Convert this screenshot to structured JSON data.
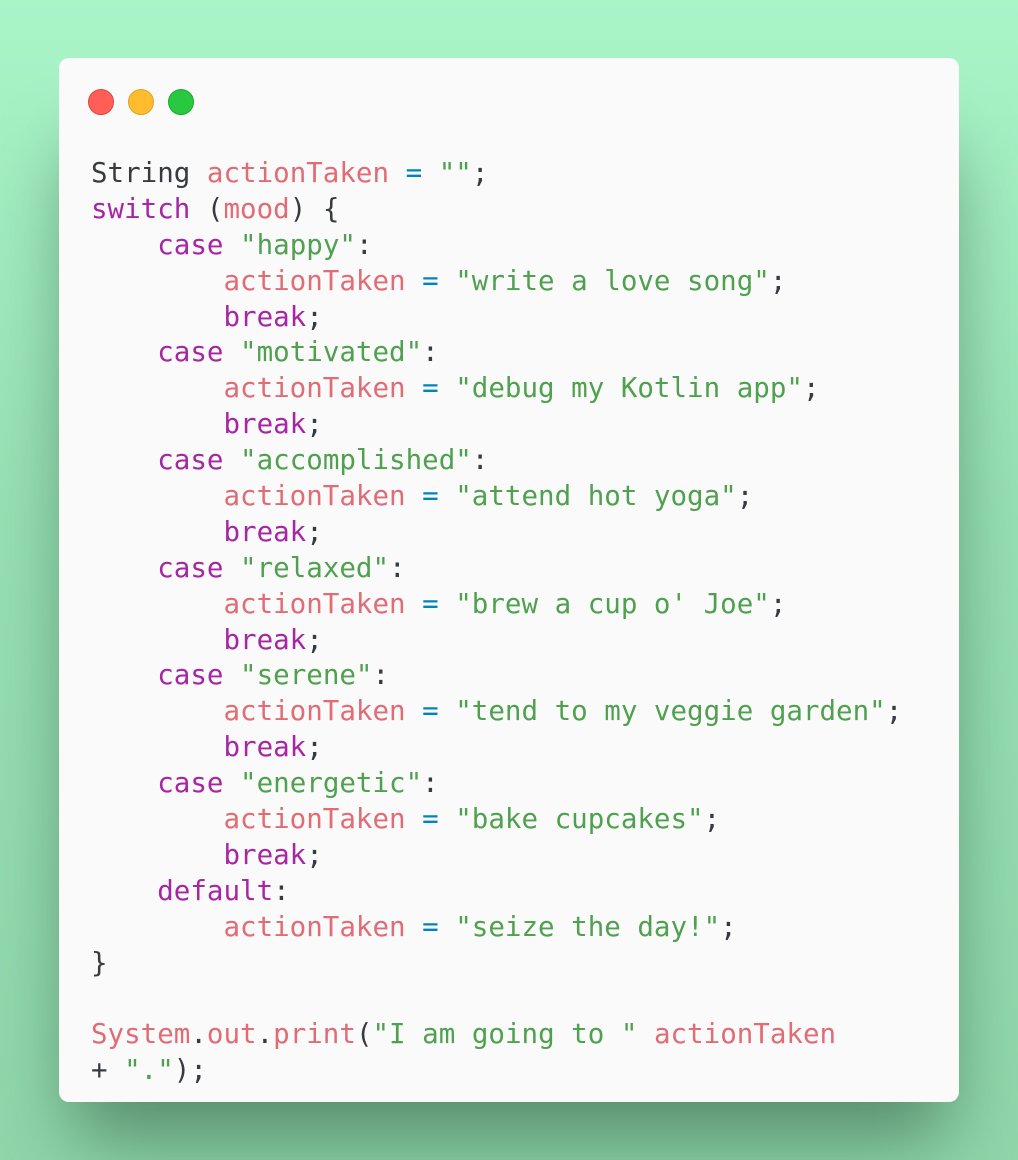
{
  "window": {
    "controls": {
      "close_color": "#ff5f57",
      "minimize_color": "#febc2e",
      "maximize_color": "#28c840"
    }
  },
  "colors": {
    "background": "#a9f5c8",
    "panel": "#fafafa",
    "plain": "#383a42",
    "keyword": "#a626a4",
    "variable": "#e06c75",
    "string": "#50a14f",
    "operator": "#0184bc"
  },
  "code": {
    "language": "java",
    "lines": [
      [
        [
          "plain",
          "String "
        ],
        [
          "var",
          "actionTaken"
        ],
        [
          "op",
          " = "
        ],
        [
          "str",
          "\"\""
        ],
        [
          "plain",
          ";"
        ]
      ],
      [
        [
          "kw",
          "switch"
        ],
        [
          "plain",
          " ("
        ],
        [
          "var",
          "mood"
        ],
        [
          "plain",
          ") {"
        ]
      ],
      [
        [
          "plain",
          "    "
        ],
        [
          "kw",
          "case"
        ],
        [
          "plain",
          " "
        ],
        [
          "str",
          "\"happy\""
        ],
        [
          "plain",
          ":"
        ]
      ],
      [
        [
          "plain",
          "        "
        ],
        [
          "var",
          "actionTaken"
        ],
        [
          "op",
          " = "
        ],
        [
          "str",
          "\"write a love song\""
        ],
        [
          "plain",
          ";"
        ]
      ],
      [
        [
          "plain",
          "        "
        ],
        [
          "kw",
          "break"
        ],
        [
          "plain",
          ";"
        ]
      ],
      [
        [
          "plain",
          "    "
        ],
        [
          "kw",
          "case"
        ],
        [
          "plain",
          " "
        ],
        [
          "str",
          "\"motivated\""
        ],
        [
          "plain",
          ":"
        ]
      ],
      [
        [
          "plain",
          "        "
        ],
        [
          "var",
          "actionTaken"
        ],
        [
          "op",
          " = "
        ],
        [
          "str",
          "\"debug my Kotlin app\""
        ],
        [
          "plain",
          ";"
        ]
      ],
      [
        [
          "plain",
          "        "
        ],
        [
          "kw",
          "break"
        ],
        [
          "plain",
          ";"
        ]
      ],
      [
        [
          "plain",
          "    "
        ],
        [
          "kw",
          "case"
        ],
        [
          "plain",
          " "
        ],
        [
          "str",
          "\"accomplished\""
        ],
        [
          "plain",
          ":"
        ]
      ],
      [
        [
          "plain",
          "        "
        ],
        [
          "var",
          "actionTaken"
        ],
        [
          "op",
          " = "
        ],
        [
          "str",
          "\"attend hot yoga\""
        ],
        [
          "plain",
          ";"
        ]
      ],
      [
        [
          "plain",
          "        "
        ],
        [
          "kw",
          "break"
        ],
        [
          "plain",
          ";"
        ]
      ],
      [
        [
          "plain",
          "    "
        ],
        [
          "kw",
          "case"
        ],
        [
          "plain",
          " "
        ],
        [
          "str",
          "\"relaxed\""
        ],
        [
          "plain",
          ":"
        ]
      ],
      [
        [
          "plain",
          "        "
        ],
        [
          "var",
          "actionTaken"
        ],
        [
          "op",
          " = "
        ],
        [
          "str",
          "\"brew a cup o' Joe\""
        ],
        [
          "plain",
          ";"
        ]
      ],
      [
        [
          "plain",
          "        "
        ],
        [
          "kw",
          "break"
        ],
        [
          "plain",
          ";"
        ]
      ],
      [
        [
          "plain",
          "    "
        ],
        [
          "kw",
          "case"
        ],
        [
          "plain",
          " "
        ],
        [
          "str",
          "\"serene\""
        ],
        [
          "plain",
          ":"
        ]
      ],
      [
        [
          "plain",
          "        "
        ],
        [
          "var",
          "actionTaken"
        ],
        [
          "op",
          " = "
        ],
        [
          "str",
          "\"tend to my veggie garden\""
        ],
        [
          "plain",
          ";"
        ]
      ],
      [
        [
          "plain",
          "        "
        ],
        [
          "kw",
          "break"
        ],
        [
          "plain",
          ";"
        ]
      ],
      [
        [
          "plain",
          "    "
        ],
        [
          "kw",
          "case"
        ],
        [
          "plain",
          " "
        ],
        [
          "str",
          "\"energetic\""
        ],
        [
          "plain",
          ":"
        ]
      ],
      [
        [
          "plain",
          "        "
        ],
        [
          "var",
          "actionTaken"
        ],
        [
          "op",
          " = "
        ],
        [
          "str",
          "\"bake cupcakes\""
        ],
        [
          "plain",
          ";"
        ]
      ],
      [
        [
          "plain",
          "        "
        ],
        [
          "kw",
          "break"
        ],
        [
          "plain",
          ";"
        ]
      ],
      [
        [
          "plain",
          "    "
        ],
        [
          "kw",
          "default"
        ],
        [
          "plain",
          ":"
        ]
      ],
      [
        [
          "plain",
          "        "
        ],
        [
          "var",
          "actionTaken"
        ],
        [
          "op",
          " = "
        ],
        [
          "str",
          "\"seize the day!\""
        ],
        [
          "plain",
          ";"
        ]
      ],
      [
        [
          "plain",
          "}"
        ]
      ],
      [],
      [
        [
          "var",
          "System"
        ],
        [
          "plain",
          "."
        ],
        [
          "var",
          "out"
        ],
        [
          "plain",
          "."
        ],
        [
          "var",
          "print"
        ],
        [
          "plain",
          "("
        ],
        [
          "str",
          "\"I am going to \""
        ],
        [
          "plain",
          " "
        ],
        [
          "var",
          "actionTaken"
        ]
      ],
      [
        [
          "plain",
          "+ "
        ],
        [
          "str",
          "\".\""
        ],
        [
          "plain",
          ");"
        ]
      ]
    ]
  }
}
